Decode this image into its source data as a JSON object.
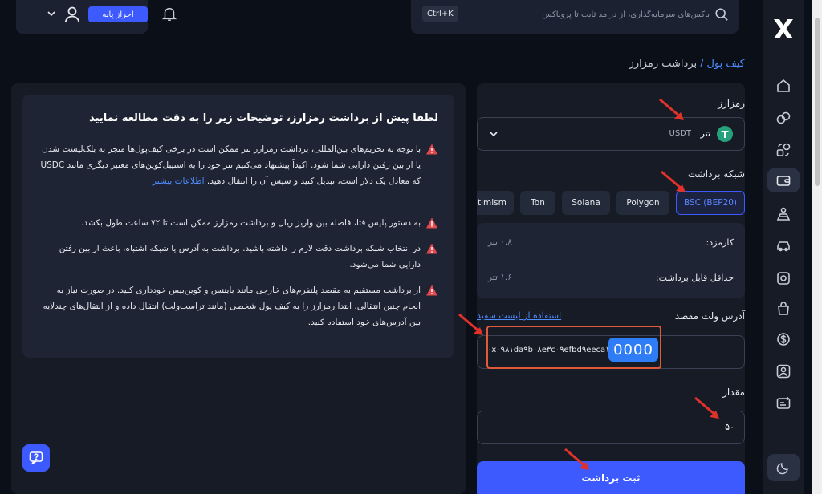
{
  "header": {
    "kyc_button": "احراز پایه",
    "search_placeholder": "باکس‌های سرمایه‌گذاری، از درآمد ثابت تا پروباکس",
    "shortcut": "Ctrl+K"
  },
  "breadcrumb": {
    "wallet": "کیف پول",
    "separator": "/",
    "current": "برداشت رمزارز"
  },
  "info": {
    "title": "لطفا پیش از برداشت رمزارز، توضیحات زیر را به دقت مطالعه نمایید",
    "notes": [
      "با توجه به تحریم‌های بین‌المللی، برداشت رمزارز تتر ممکن است در برخی کیف‌پول‌ها منجر به بلک‌لیست شدن یا از بین رفتن دارایی شما شود. اکیداً پیشنهاد می‌کنیم تتر خود را به استیبل‌کوین‌های معتبر دیگری مانند USDC که معادل یک دلار است، تبدیل کنید و سپس آن را انتقال دهید.",
      "به دستور پلیس فتا، فاصله بین واریز ریال و برداشت رمزارز ممکن است تا ۷۲ ساعت طول بکشد.",
      "در انتخاب شبکه برداشت دقت لازم را داشته باشید. برداشت به آدرس یا شبکه اشتباه، باعث از بین رفتن دارایی شما می‌شود.",
      "از برداشت مستقیم به مقصد پلتفرم‌های خارجی مانند بایننس و کوین‌بیس خودداری کنید. در صورت نیاز به انجام چنین انتقالی، ابتدا رمزارز را به کیف پول شخصی (مانند تراست‌ولت) انتقال داده و از انتقال‌های چندلایه بین آدرس‌های خود استفاده کنید."
    ],
    "more_link": "اطلاعات بیشتر"
  },
  "form": {
    "currency_label": "رمزارز",
    "currency_name": "تتر",
    "currency_code": "USDT",
    "network_label": "شبکه برداشت",
    "networks": [
      "BSC (BEP20)",
      "Polygon",
      "Solana",
      "Ton",
      "timism"
    ],
    "active_network": "BSC (BEP20)",
    "fee_label": "کارمزد:",
    "fee_value": "۰.۸ تتر",
    "min_label": "حداقل قابل برداشت:",
    "min_value": "۱.۶ تتر",
    "address_label": "آدرس ولت مقصد",
    "whitelist_link": "استفاده از لیست سفید",
    "address_value": "۰x۰۹۸۱da۹b۰۸e۳c۰۹efbd۹eeca۱۶c",
    "address_mask": "0000",
    "amount_label": "مقدار",
    "amount_value": "۵۰",
    "submit": "ثبت برداشت"
  },
  "colors": {
    "accent": "#3d5afe",
    "link": "#4f8cff",
    "warning": "#e5484d",
    "annotation": "#e0312b"
  }
}
